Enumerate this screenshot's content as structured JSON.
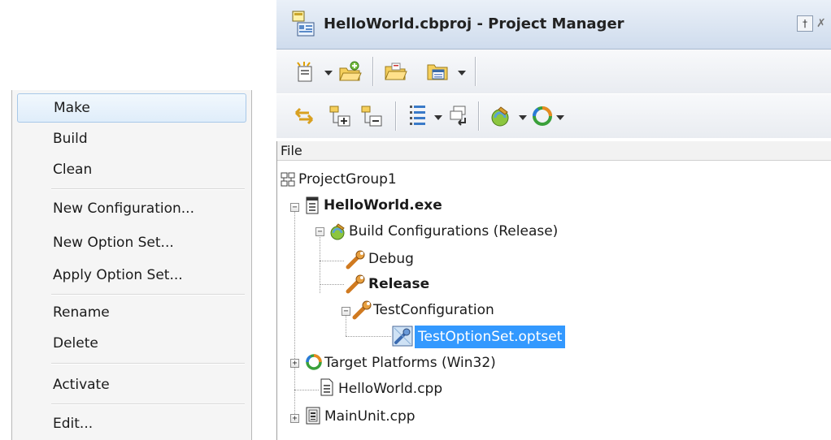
{
  "context_menu": {
    "items": [
      {
        "label": "Make",
        "highlighted": true
      },
      {
        "label": "Build"
      },
      {
        "label": "Clean"
      },
      {
        "label": "New Configuration..."
      },
      {
        "label": "New Option Set..."
      },
      {
        "label": "Apply Option Set..."
      },
      {
        "label": "Rename"
      },
      {
        "label": "Delete"
      },
      {
        "label": "Activate"
      },
      {
        "label": "Edit..."
      }
    ]
  },
  "project_manager": {
    "title": "HelloWorld.cbproj - Project Manager",
    "pin_glyph": "†",
    "close_glyph": "✗",
    "column_header": "File",
    "tree": {
      "group": "ProjectGroup1",
      "project": "HelloWorld.exe",
      "build_configs": "Build Configurations (Release)",
      "debug": "Debug",
      "release": "Release",
      "test_config": "TestConfiguration",
      "option_set": "TestOptionSet.optset",
      "target_platforms": "Target Platforms (Win32)",
      "hello_cpp": "HelloWorld.cpp",
      "main_unit": "MainUnit.cpp"
    }
  },
  "colors": {
    "selection": "#3399ff",
    "menu_highlight_border": "#a8c8e8",
    "title_bar": "#cfdced"
  }
}
